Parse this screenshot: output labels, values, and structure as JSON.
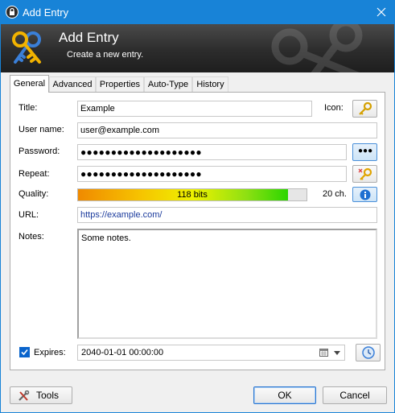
{
  "window": {
    "title": "Add Entry"
  },
  "banner": {
    "title": "Add Entry",
    "subtitle": "Create a new entry."
  },
  "tabs": [
    {
      "label": "General",
      "active": true
    },
    {
      "label": "Advanced",
      "active": false
    },
    {
      "label": "Properties",
      "active": false
    },
    {
      "label": "Auto-Type",
      "active": false
    },
    {
      "label": "History",
      "active": false
    }
  ],
  "form": {
    "title_label": "Title:",
    "title_value": "Example",
    "icon_label": "Icon:",
    "username_label": "User name:",
    "username_value": "user@example.com",
    "password_label": "Password:",
    "password_value": "●●●●●●●●●●●●●●●●●●●●",
    "reveal_button_label": "●●●",
    "repeat_label": "Repeat:",
    "repeat_value": "●●●●●●●●●●●●●●●●●●●●",
    "quality_label": "Quality:",
    "quality_text": "118 bits",
    "quality_fraction": 0.92,
    "char_count": "20 ch.",
    "url_label": "URL:",
    "url_value": "https://example.com/",
    "notes_label": "Notes:",
    "notes_value": "Some notes.",
    "expires_label": "Expires:",
    "expires_checked": true,
    "expires_value": "2040-01-01 00:00:00"
  },
  "footer": {
    "tools_label": "Tools",
    "ok_label": "OK",
    "cancel_label": "Cancel"
  },
  "colors": {
    "titlebar": "#1883d7",
    "accent": "#0a64cc",
    "link": "#1a3a9c"
  },
  "icons": [
    "app-lock-icon",
    "close-icon",
    "keys-icon",
    "key-icon",
    "password-generator-icon",
    "info-icon",
    "calendar-icon",
    "clock-icon",
    "tools-icon"
  ]
}
